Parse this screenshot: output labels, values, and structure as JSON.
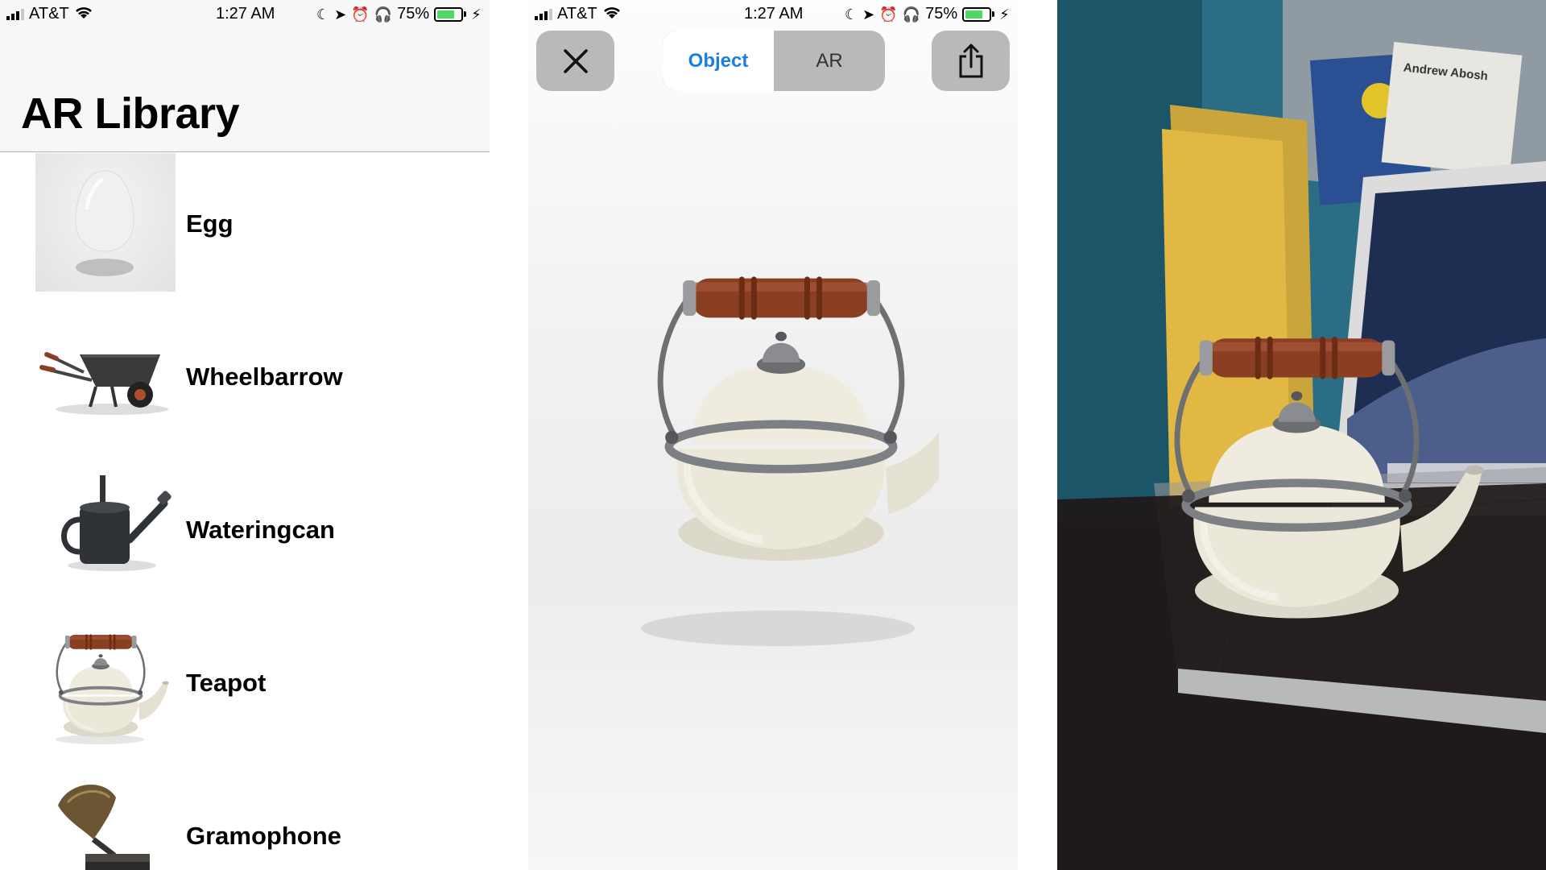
{
  "status_bar": {
    "carrier": "AT&T",
    "time": "1:27 AM",
    "battery_percent": "75%",
    "battery_level": 0.75,
    "battery_color": "#4cd964"
  },
  "library": {
    "title": "AR Library",
    "items": [
      {
        "label": "Egg",
        "icon": "egg-thumbnail"
      },
      {
        "label": "Wheelbarrow",
        "icon": "wheelbarrow-thumbnail"
      },
      {
        "label": "Wateringcan",
        "icon": "wateringcan-thumbnail"
      },
      {
        "label": "Teapot",
        "icon": "teapot-thumbnail"
      },
      {
        "label": "Gramophone",
        "icon": "gramophone-thumbnail"
      }
    ]
  },
  "viewer": {
    "close_icon": "close-icon",
    "share_icon": "share-icon",
    "segments": [
      {
        "label": "Object",
        "selected": true
      },
      {
        "label": "AR",
        "selected": false
      }
    ],
    "accent_color": "#1a7ee6",
    "model": "teapot-3d-model"
  },
  "ar_scene": {
    "card_text": "Andrew Abosh"
  }
}
